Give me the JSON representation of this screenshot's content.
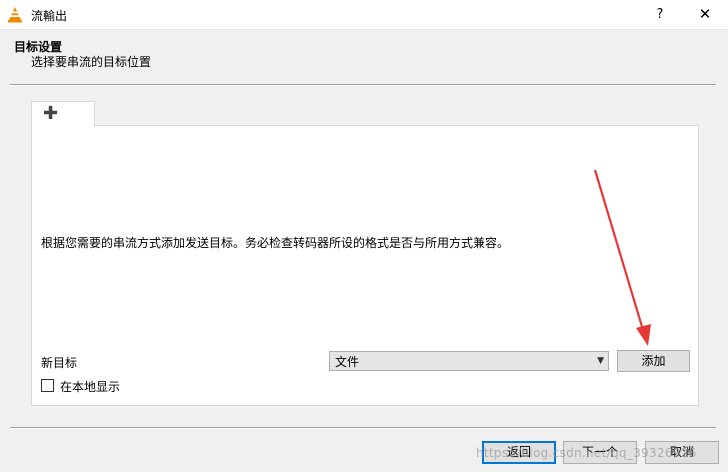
{
  "window": {
    "title": "流輸出",
    "help_label": "?",
    "close_label": "✕"
  },
  "header": {
    "title": "目标设置",
    "subtitle": "选择要串流的目标位置"
  },
  "tab": {
    "icon": "plus-icon",
    "label": "✚"
  },
  "panel": {
    "info_text": "根据您需要的串流方式添加发送目标。务必检查转码器所设的格式是否与所用方式兼容。",
    "new_target_label": "新目标",
    "select_value": "文件",
    "add_button": "添加",
    "local_display_label": "在本地显示",
    "local_display_checked": false
  },
  "footer": {
    "back_button": "返回",
    "next_button": "下一个",
    "cancel_button": "取消"
  },
  "watermark": "https://blog.csdn.net/qq_39326926",
  "colors": {
    "accent": "#0078d7",
    "annotation_arrow": "#e53935",
    "vlc_orange": "#f08a00"
  }
}
